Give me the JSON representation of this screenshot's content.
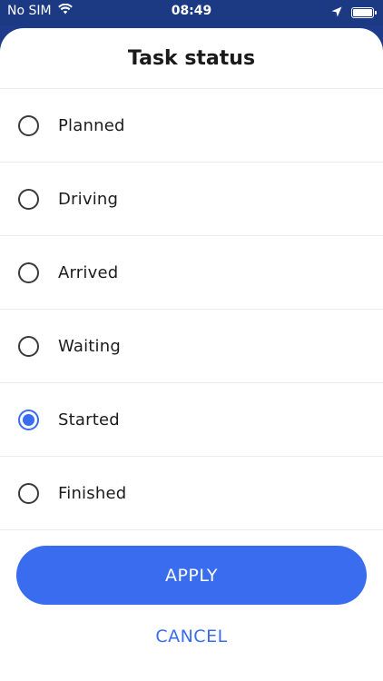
{
  "status_bar": {
    "carrier": "No SIM",
    "time": "08:49"
  },
  "sheet": {
    "title": "Task status",
    "options": [
      {
        "label": "Planned",
        "selected": false
      },
      {
        "label": "Driving",
        "selected": false
      },
      {
        "label": "Arrived",
        "selected": false
      },
      {
        "label": "Waiting",
        "selected": false
      },
      {
        "label": "Started",
        "selected": true
      },
      {
        "label": "Finished",
        "selected": false
      }
    ],
    "apply_label": "APPLY",
    "cancel_label": "CANCEL"
  },
  "colors": {
    "accent": "#3a6cf0",
    "status_bar_bg": "#1c3a84"
  },
  "icons": {
    "wifi": "wifi-icon",
    "location": "location-arrow-icon",
    "battery": "battery-icon",
    "radio_on": "radio-selected-icon",
    "radio_off": "radio-unselected-icon"
  }
}
